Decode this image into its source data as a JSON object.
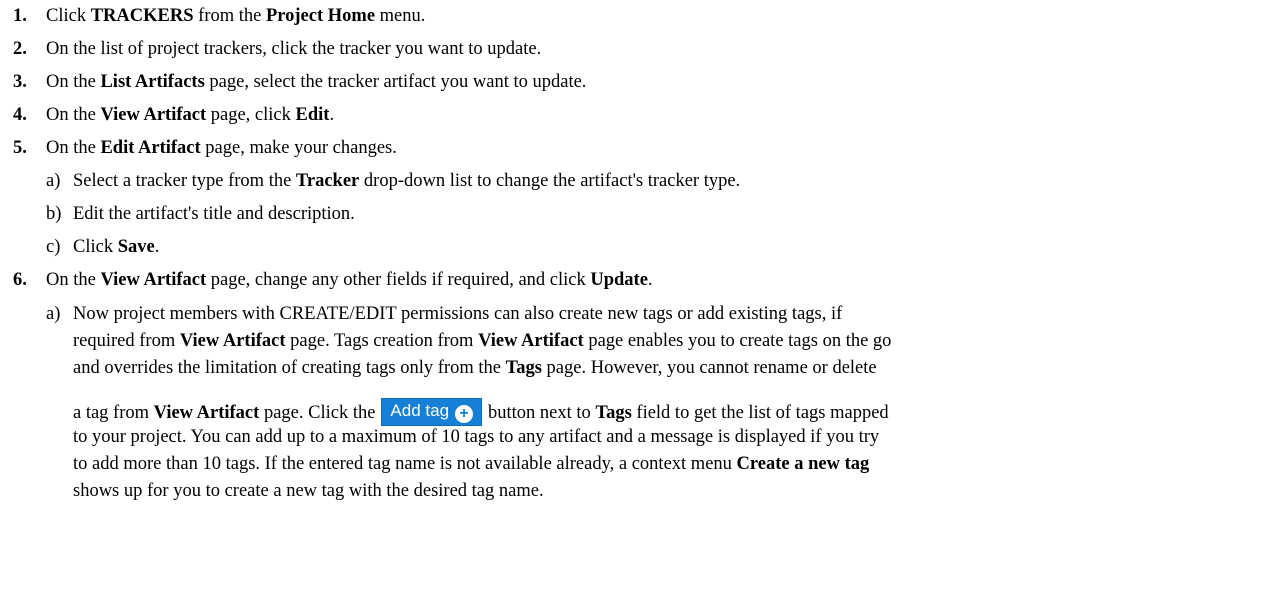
{
  "steps": [
    {
      "num": "1.",
      "t1": "Click ",
      "b1": "TRACKERS",
      "t2": " from the ",
      "b2": "Project Home",
      "t3": " menu."
    },
    {
      "num": "2.",
      "t1": "On the list of project trackers, click the tracker you want to update."
    },
    {
      "num": "3.",
      "t1": "On the ",
      "b1": "List Artifacts",
      "t2": " page, select the tracker artifact you want to update."
    },
    {
      "num": "4.",
      "t1": "On the ",
      "b1": "View Artifact",
      "t2": " page, click ",
      "b2": "Edit",
      "t3": "."
    },
    {
      "num": "5.",
      "t1": "On the ",
      "b1": "Edit Artifact",
      "t2": " page, make your changes."
    },
    {
      "num": "6.",
      "t1": "On the ",
      "b1": "View Artifact",
      "t2": " page, change any other fields if required, and click ",
      "b2": "Update",
      "t3": "."
    }
  ],
  "substeps5": [
    {
      "letter": "a)",
      "t1": "Select a tracker type from the ",
      "b1": "Tracker",
      "t2": " drop-down list to change the artifact's tracker type."
    },
    {
      "letter": "b)",
      "t1": "Edit the artifact's title and description."
    },
    {
      "letter": "c)",
      "t1": "Click ",
      "b1": "Save",
      "t2": "."
    }
  ],
  "substep6a": {
    "letter": "a)",
    "l1": "Now project members with CREATE/EDIT permissions can also create new tags or add existing tags, if",
    "l2_t1": "required from ",
    "l2_b1": "View Artifact",
    "l2_t2": " page. Tags creation from ",
    "l2_b2": "View Artifact",
    "l2_t3": " page enables you to create tags on the go",
    "l3_t1": "and overrides the limitation of creating tags only from the ",
    "l3_b1": "Tags",
    "l3_t2": "  page. However, you cannot rename or delete",
    "l4_t1": "a tag from ",
    "l4_b1": "View Artifact",
    "l4_t2": " page. Click the",
    "l4_t3": "button next to ",
    "l4_b2": "Tags",
    "l4_t4": " field to get the list of tags mapped",
    "l5": "to your project. You can add up to a maximum of 10 tags to any artifact and a message is displayed if you try",
    "l6_t1": "to add more than 10 tags. If the entered tag name is not available already, a context menu ",
    "l6_b1": "Create a new tag",
    "l7": "shows up for you to create a new tag with the desired tag name."
  },
  "add_tag_button": {
    "label": "Add tag",
    "icon": "plus-circle-icon"
  },
  "colors": {
    "button_bg": "#1680d6",
    "text": "#000000"
  }
}
